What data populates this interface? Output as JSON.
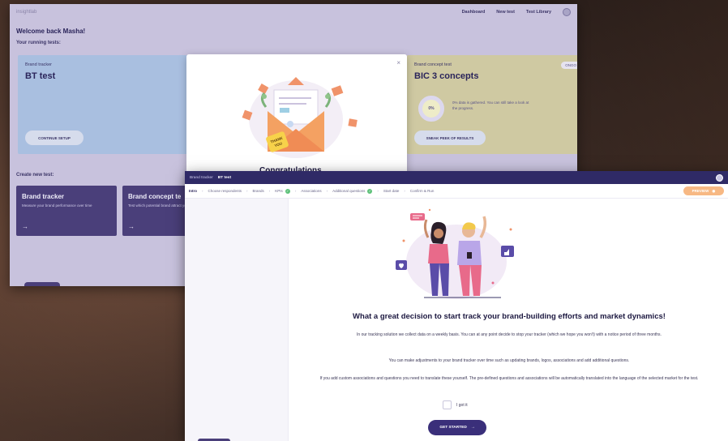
{
  "dashboard": {
    "logo_text": "insightlab",
    "nav": [
      "Dashboard",
      "New test",
      "Test Library"
    ],
    "welcome": "Welcome back Masha!",
    "running_label": "Your running tests:",
    "bt_card": {
      "type": "Brand tracker",
      "title": "BT test",
      "pill": "✎",
      "button": "CONTINUE SETUP"
    },
    "bic_card": {
      "type": "Brand concept test",
      "title": "BIC 3 concepts",
      "pill": "ONGO",
      "progress": "0%",
      "progress_text": "0% data is gathered. You can still take a look at the progress.",
      "button": "SNEAK PEEK OF RESULTS"
    },
    "create_label": "Create new test:",
    "new_tests": [
      {
        "title": "Brand tracker",
        "desc": "Measure your brand performance over time",
        "arrow": "→"
      },
      {
        "title": "Brand concept te",
        "desc": "Test which potential brand attract your audience",
        "arrow": "→"
      }
    ]
  },
  "modal": {
    "close": "×",
    "thank_you": "THANK YOU",
    "bottom_text": "Congratulations"
  },
  "tracker": {
    "crumbs": [
      "Brand tracker",
      "BT test"
    ],
    "steps": [
      {
        "label": "Intro",
        "active": true,
        "done": false
      },
      {
        "label": "Choose respondents",
        "active": false,
        "done": false
      },
      {
        "label": "Brands",
        "active": false,
        "done": false
      },
      {
        "label": "KPIs",
        "active": false,
        "done": true
      },
      {
        "label": "Associations",
        "active": false,
        "done": false
      },
      {
        "label": "Additional questions",
        "active": false,
        "done": true
      },
      {
        "label": "Start date",
        "active": false,
        "done": false
      },
      {
        "label": "Confirm & Run",
        "active": false,
        "done": false
      }
    ],
    "preview": "PREVIEW",
    "heading": "What a great decision to start track your brand-building efforts and market dynamics!",
    "p1": "In our tracking solution we collect data on a weekly basis. You can at any point decide to stop your tracker (which we hope you won't) with a notice period of three months.",
    "p2": "You can make adjustments to your brand tracker over time such as updating brands, logos, associations and add additional questions.",
    "p3": "If you add custom associations and questions you need to translate these yourself. The pre-defined questions and associations will be automatically translated into the language of the selected market for the test.",
    "got_it": "I got it",
    "get_started": "GET STARTED",
    "get_started_arrow": "→"
  },
  "colors": {
    "brand_dark": "#2f2a66",
    "accent_orange": "#f7b884",
    "done_green": "#5ec17a"
  }
}
